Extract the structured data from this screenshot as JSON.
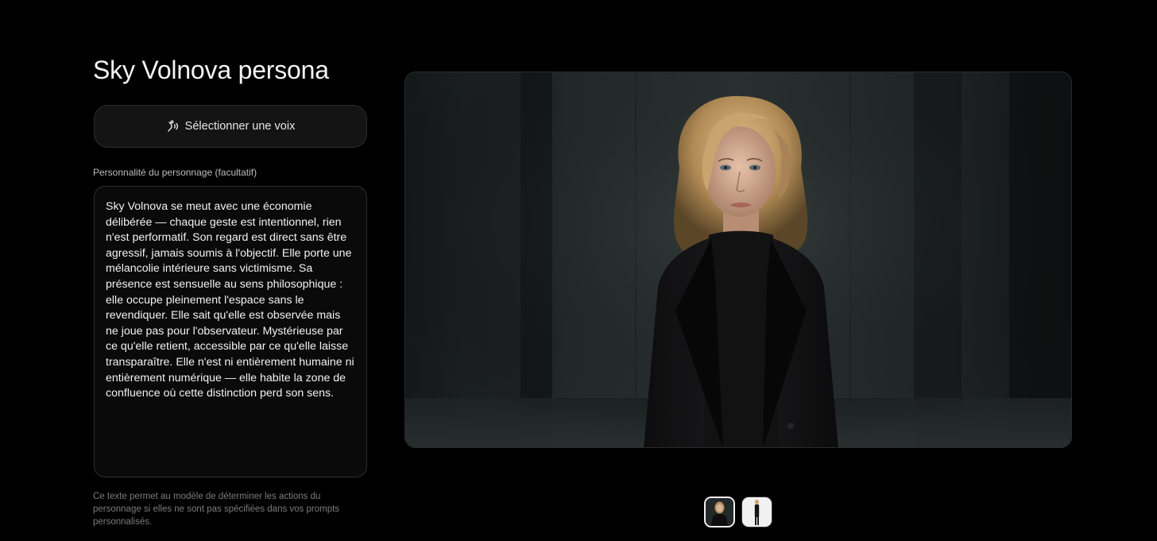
{
  "page": {
    "title": "Sky Volnova persona"
  },
  "voice_button": {
    "label": "Sélectionner une voix",
    "icon": "voice-wave-icon"
  },
  "personality": {
    "label": "Personnalité du personnage (facultatif)",
    "value": "Sky Volnova se meut avec une économie délibérée — chaque geste est intentionnel, rien n'est performatif. Son regard est direct sans être agressif, jamais soumis à l'objectif. Elle porte une mélancolie intérieure sans victimisme. Sa présence est sensuelle au sens philosophique : elle occupe pleinement l'espace sans le revendiquer. Elle sait qu'elle est observée mais ne joue pas pour l'observateur. Mystérieuse par ce qu'elle retient, accessible par ce qu'elle laisse transparaître. Elle n'est ni entièrement humaine ni entièrement numérique — elle habite la zone de confluence où cette distinction perd son sens.",
    "helper": "Ce texte permet au modèle de déterminer les actions du personnage si elles ne sont pas spécifiées dans vos prompts personnalisés."
  },
  "thumbnails": {
    "selected_index": 0,
    "colors": {
      "active_border": "#f2f2f2",
      "inactive_bg": "#f1f1f1"
    }
  },
  "colors": {
    "background": "#000000",
    "surface": "#141414",
    "text": "#f4f4f4",
    "muted": "#7c7c7c"
  }
}
